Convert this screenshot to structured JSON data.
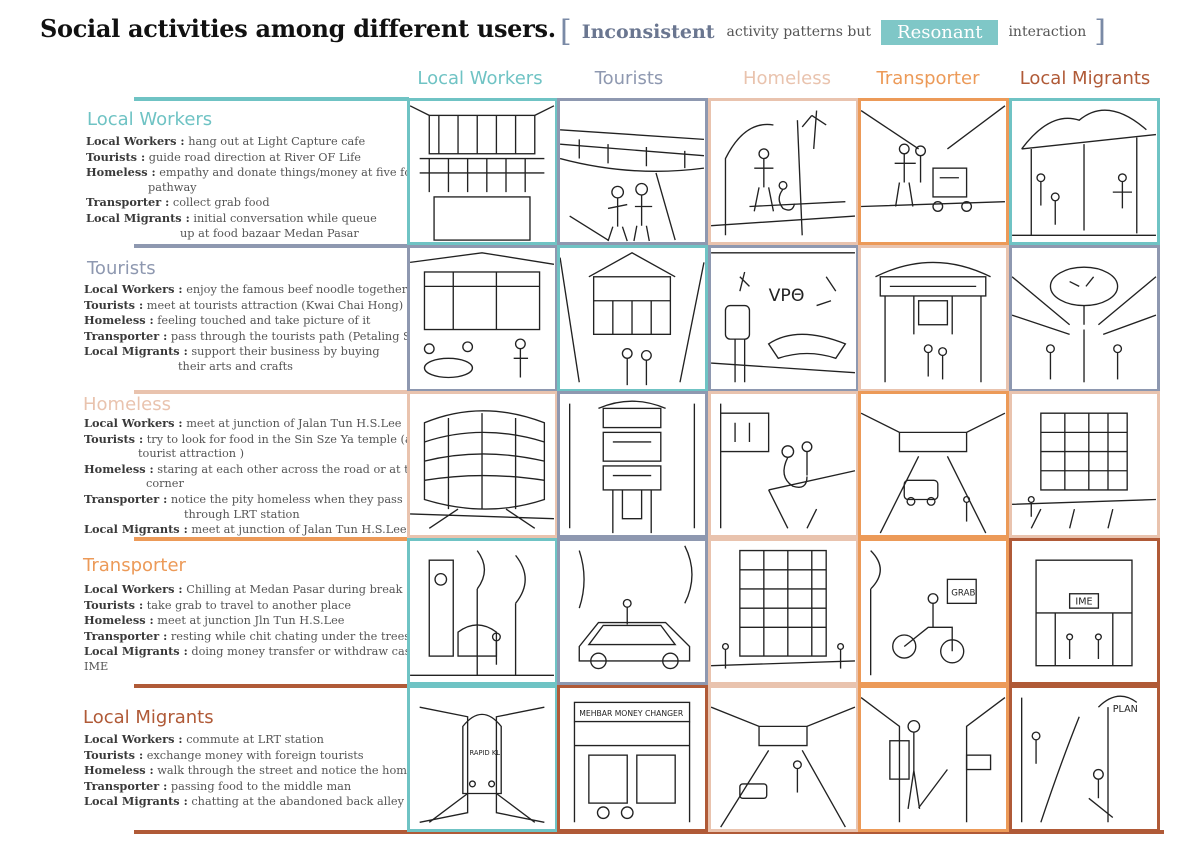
{
  "title": "Social activities among different users.",
  "legend": {
    "open": "[",
    "inconsistent": "Inconsistent",
    "middle": "activity patterns but",
    "resonant": "Resonant",
    "end": "interaction",
    "close": "]"
  },
  "colors": {
    "local_workers": "#6fc3c4",
    "tourists": "#8e98b0",
    "homeless": "#e9c3ae",
    "transporter": "#ec9a58",
    "local_migrants": "#b05a37"
  },
  "columns": [
    "Local Workers",
    "Tourists",
    "Homeless",
    "Transporter",
    "Local Migrants"
  ],
  "rows": [
    {
      "title": "Local Workers",
      "lines": [
        {
          "label": "Local Workers :",
          "text": "hang out at Light Capture cafe"
        },
        {
          "label": "Tourists :",
          "text": "guide road direction at River OF Life"
        },
        {
          "label": "Homeless :",
          "text": "empathy and donate things/money at five foot",
          "cont": "pathway"
        },
        {
          "label": "Transporter :",
          "text": "collect grab food"
        },
        {
          "label": "Local Migrants :",
          "text": "initial conversation while queue",
          "cont": "up at food bazaar Medan Pasar"
        }
      ]
    },
    {
      "title": "Tourists",
      "lines": [
        {
          "label": "Local Workers :",
          "text": "enjoy the famous beef noodle  together"
        },
        {
          "label": "Tourists :",
          "text": "meet at tourists attraction (Kwai Chai Hong)"
        },
        {
          "label": "Homeless :",
          "text": " feeling touched and take picture of it"
        },
        {
          "label": "Transporter :",
          "text": "pass through the tourists path (Petaling Street)"
        },
        {
          "label": "Local Migrants :",
          "text": "support their business by buying",
          "cont": "their arts and crafts"
        }
      ]
    },
    {
      "title": "Homeless",
      "lines": [
        {
          "label": "Local Workers :",
          "text": "meet at junction of Jalan Tun H.S.Lee"
        },
        {
          "label": "Tourists :",
          "text": "try to look for food in the Sin Sze Ya temple (a",
          "cont": "tourist attraction )"
        },
        {
          "label": "Homeless :",
          "text": " staring at each other across the road or at the",
          "cont": "corner"
        },
        {
          "label": "Transporter :",
          "text": "notice the pity homeless when they pass",
          "cont": "through LRT station"
        },
        {
          "label": "Local Migrants :",
          "text": "meet at junction of Jalan Tun H.S.Lee"
        }
      ]
    },
    {
      "title": "Transporter",
      "lines": [
        {
          "label": "Local Workers :",
          "text": "Chilling at Medan Pasar during break"
        },
        {
          "label": "Tourists :",
          "text": "take grab to travel to another place"
        },
        {
          "label": "Homeless :",
          "text": " meet at junction Jln Tun H.S.Lee"
        },
        {
          "label": "Transporter :",
          "text": "resting while chit chating under the trees"
        },
        {
          "label": "Local Migrants :",
          "text": "doing money transfer or withdraw cash at",
          "cont": "IME"
        }
      ]
    },
    {
      "title": "Local Migrants",
      "lines": [
        {
          "label": "Local Workers :",
          "text": "commute at LRT station"
        },
        {
          "label": "Tourists :",
          "text": "exchange money with foreign tourists"
        },
        {
          "label": "Homeless :",
          "text": " walk through the street and notice the homeless"
        },
        {
          "label": "Transporter :",
          "text": "passing food to the middle man"
        },
        {
          "label": "Local Migrants :",
          "text": "chatting at the abandoned back alley"
        }
      ]
    }
  ],
  "sketch_labels": {
    "grab": "GRAB",
    "vpn": "VPΘ",
    "ime": "IME",
    "money_changer": "MEHBAR MONEY CHANGER",
    "rapid": "RAPID KL",
    "plan": "PLAN"
  }
}
